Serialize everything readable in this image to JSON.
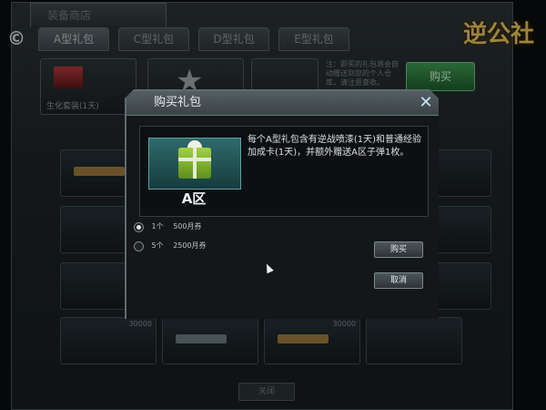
{
  "background": {
    "window_title": "装备商店",
    "brand_icon": "c-logo-icon",
    "tabs": [
      {
        "label": "A型礼包",
        "active": true
      },
      {
        "label": "C型礼包",
        "active": false
      },
      {
        "label": "D型礼包",
        "active": false
      },
      {
        "label": "E型礼包",
        "active": false
      }
    ],
    "logo_text": "逆公社",
    "top_slot_caption": "生化套装(1天)",
    "notice": "注：即买的礼包将会自动赠送到您的个人仓库，请注意查收。",
    "buy_label": "购买",
    "grid_ammo_counts": [
      "30000",
      "30000"
    ],
    "bottom_button_label": "关闭"
  },
  "dialog": {
    "title": "购买礼包",
    "close_icon": "close-x-icon",
    "item_name": "A区",
    "description": "每个A型礼包含有逆战喷漆(1天)和普通经验加成卡(1天)，并额外赠送A区子弹1枚。",
    "options": [
      {
        "quantity": "1个",
        "price": "500月券",
        "selected": true
      },
      {
        "quantity": "5个",
        "price": "2500月券",
        "selected": false
      }
    ],
    "buy_label": "购买",
    "cancel_label": "取消"
  },
  "colors": {
    "accent": "#3a9f8f",
    "close_icon": "#c9e4f2",
    "gift_green": "#8fc23a"
  }
}
